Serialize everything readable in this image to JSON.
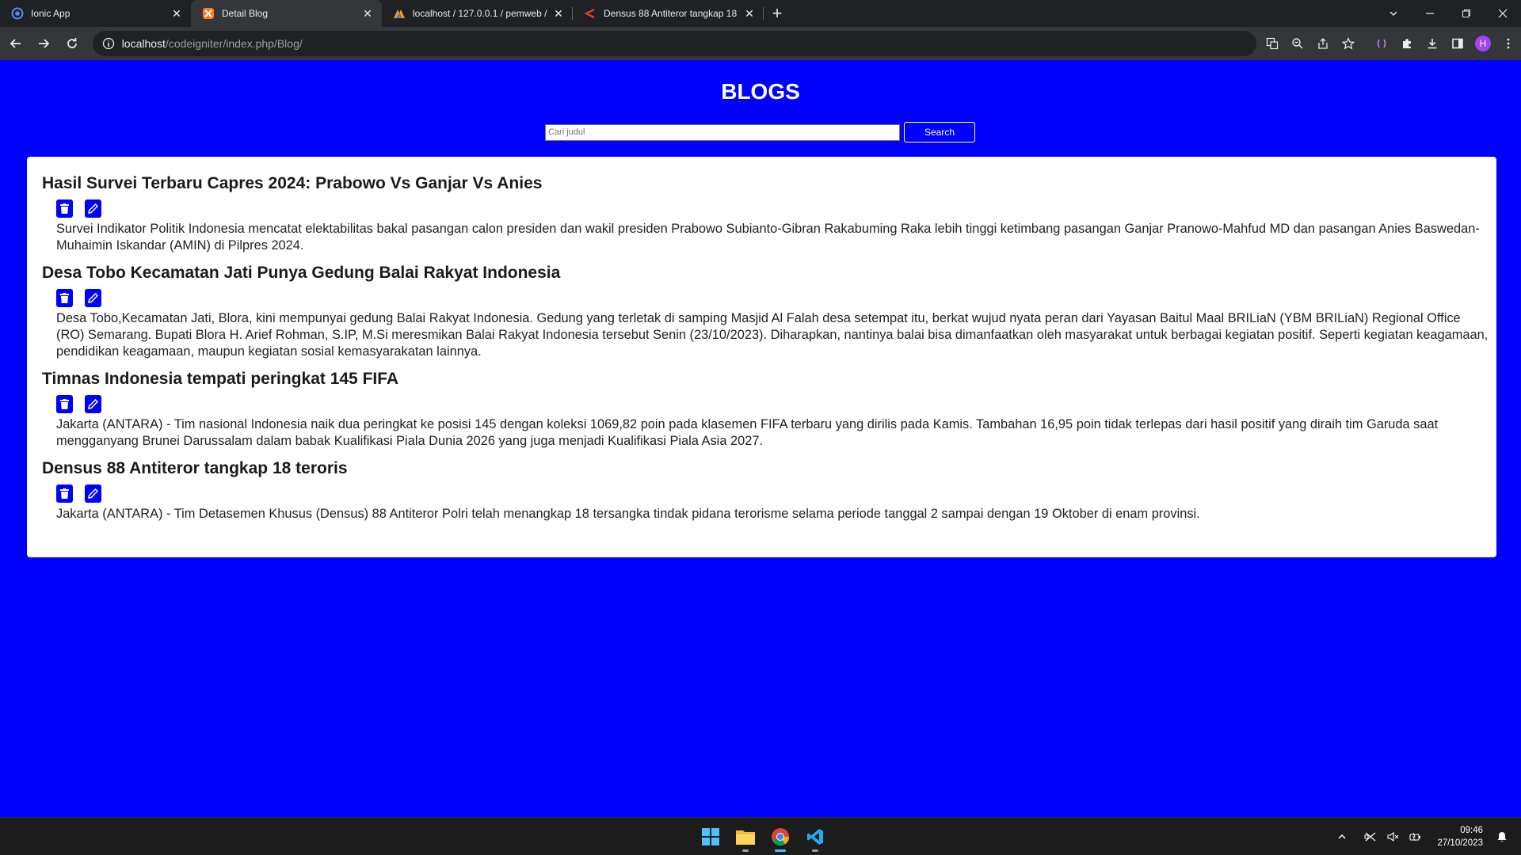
{
  "browser": {
    "tabs": [
      {
        "title": "Ionic App",
        "icon": "ionic-icon",
        "active": false
      },
      {
        "title": "Detail Blog",
        "icon": "xampp-icon",
        "active": true
      },
      {
        "title": "localhost / 127.0.0.1 / pemweb /",
        "icon": "phpmyadmin-icon",
        "active": false
      },
      {
        "title": "Densus 88 Antiteror tangkap 18",
        "icon": "codeigniter-icon",
        "active": false
      }
    ],
    "url_host": "localhost",
    "url_path": "/codeigniter/index.php/Blog/",
    "profile_initial": "H"
  },
  "page": {
    "title": "BLOGS",
    "search": {
      "placeholder": "Cari judul",
      "button_label": "Search"
    },
    "posts": [
      {
        "title": "Hasil Survei Terbaru Capres 2024: Prabowo Vs Ganjar Vs Anies",
        "body": "Survei Indikator Politik Indonesia mencatat elektabilitas bakal pasangan calon presiden dan wakil presiden Prabowo Subianto-Gibran Rakabuming Raka lebih tinggi ketimbang pasangan Ganjar Pranowo-Mahfud MD dan pasangan Anies Baswedan-Muhaimin Iskandar (AMIN) di Pilpres 2024."
      },
      {
        "title": "Desa Tobo Kecamatan Jati Punya Gedung Balai Rakyat Indonesia",
        "body": "Desa Tobo,Kecamatan Jati, Blora, kini mempunyai gedung Balai Rakyat Indonesia. Gedung yang terletak di samping Masjid Al Falah desa setempat itu, berkat wujud nyata peran dari Yayasan Baitul Maal BRILiaN (YBM BRILiaN) Regional Office (RO) Semarang. Bupati Blora H. Arief Rohman, S.IP, M.Si meresmikan Balai Rakyat Indonesia tersebut Senin (23/10/2023). Diharapkan, nantinya balai bisa dimanfaatkan oleh masyarakat untuk berbagai kegiatan positif. Seperti kegiatan keagamaan, pendidikan keagamaan, maupun kegiatan sosial kemasyarakatan lainnya."
      },
      {
        "title": "Timnas Indonesia tempati peringkat 145 FIFA",
        "body": "Jakarta (ANTARA) - Tim nasional Indonesia naik dua peringkat ke posisi 145 dengan koleksi 1069,82 poin pada klasemen FIFA terbaru yang dirilis pada Kamis. Tambahan 16,95 poin tidak terlepas dari hasil positif yang diraih tim Garuda saat mengganyang Brunei Darussalam dalam babak Kualifikasi Piala Dunia 2026 yang juga menjadi Kualifikasi Piala Asia 2027."
      },
      {
        "title": "Densus 88 Antiteror tangkap 18 teroris",
        "body": "Jakarta (ANTARA) - Tim Detasemen Khusus (Densus) 88 Antiteror Polri telah menangkap 18 tersangka tindak pidana terorisme selama periode tanggal 2 sampai dengan 19 Oktober di enam provinsi."
      }
    ]
  },
  "taskbar": {
    "time": "09:46",
    "date": "27/10/2023"
  },
  "colors": {
    "page_bg": "#0000ff",
    "card_bg": "#ffffff",
    "button_bg": "#0000ff"
  }
}
